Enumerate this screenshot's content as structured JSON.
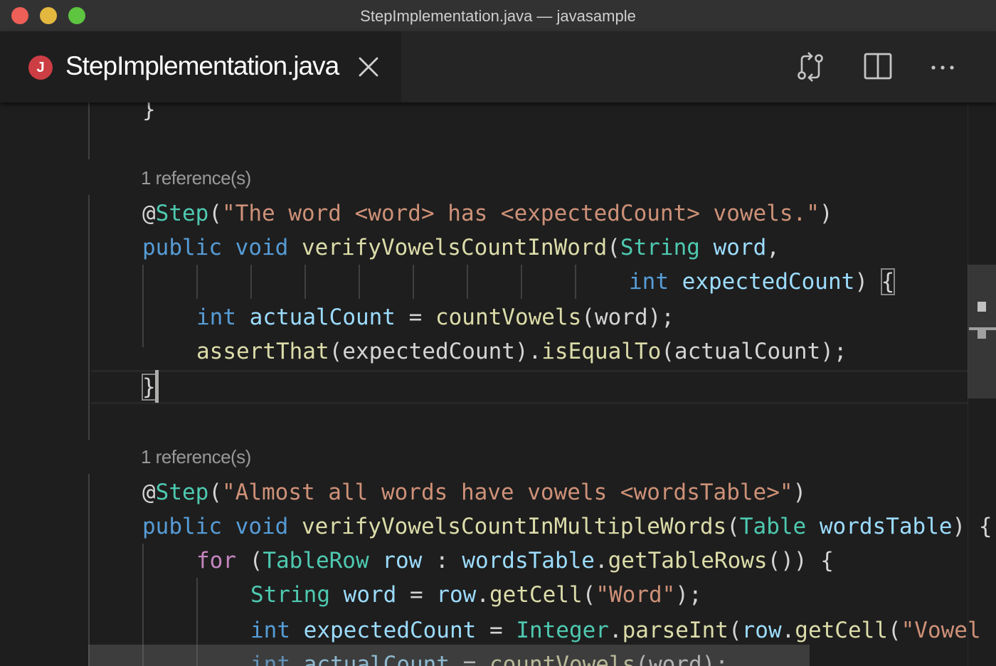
{
  "window": {
    "title": "StepImplementation.java — javasample"
  },
  "tab": {
    "icon_letter": "J",
    "label": "StepImplementation.java",
    "icon": "java-file-icon"
  },
  "actions": {
    "compare_icon": "compare-changes-icon",
    "split_icon": "split-editor-icon",
    "more_icon": "more-actions-icon"
  },
  "editor": {
    "lens1": "1 reference(s)",
    "lens2": "1 reference(s)",
    "lines": {
      "l0": {
        "brace": "}"
      },
      "l1": {
        "at": "@",
        "step": "Step",
        "open": "(",
        "str": "\"The word <word> has <expectedCount> vowels.\"",
        "close": ")"
      },
      "l2": {
        "public": "public",
        "void": "void",
        "method": "verifyVowelsCountInWord",
        "open": "(",
        "type": "String",
        "param": "word",
        "comma": ","
      },
      "l3": {
        "type": "int",
        "param": "expectedCount",
        "close": ")",
        "brace": "{"
      },
      "l4": {
        "type": "int",
        "var": "actualCount",
        "eq": " = ",
        "fn": "countVowels",
        "rest": "(word);"
      },
      "l5": {
        "fn1": "assertThat",
        "mid": "(expectedCount).",
        "fn2": "isEqualTo",
        "rest": "(actualCount);"
      },
      "l6": {
        "brace": "}"
      },
      "l7": {
        "at": "@",
        "step": "Step",
        "open": "(",
        "str": "\"Almost all words have vowels <wordsTable>\"",
        "close": ")"
      },
      "l8": {
        "public": "public",
        "void": "void",
        "method": "verifyVowelsCountInMultipleWords",
        "open": "(",
        "type": "Table",
        "param": "wordsTable",
        "close": ") {"
      },
      "l9": {
        "for": "for",
        "open": " (",
        "type": "TableRow",
        "var": "row",
        "colon": " : ",
        "obj": "wordsTable",
        "dot": ".",
        "fn": "getTableRows",
        "close": "()) {"
      },
      "l10": {
        "type": "String",
        "var": "word",
        "eq": " = ",
        "obj": "row",
        "dot": ".",
        "fn": "getCell",
        "open": "(",
        "str": "\"Word\"",
        "close": ");"
      },
      "l11": {
        "type": "int",
        "var": "expectedCount",
        "eq": " = ",
        "cls": "Integer",
        "dot": ".",
        "fn": "parseInt",
        "open": "(",
        "obj": "row",
        "dot2": ".",
        "fn2": "getCell",
        "open2": "(",
        "str": "\"Vowel"
      },
      "l12": {
        "type": "int",
        "var": "actualCount",
        "eq": " = ",
        "fn": "countVowels",
        "rest": "(word);"
      }
    }
  }
}
